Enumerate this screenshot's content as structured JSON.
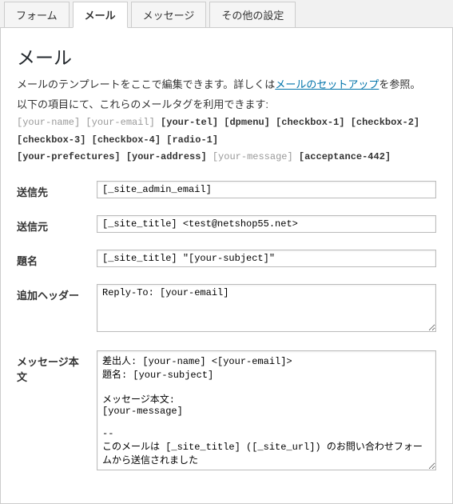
{
  "tabs": {
    "form": "フォーム",
    "mail": "メール",
    "messages": "メッセージ",
    "other": "その他の設定"
  },
  "heading": "メール",
  "desc_pre": "メールのテンプレートをここで編集できます。詳しくは",
  "desc_link": "メールのセットアップ",
  "desc_post": "を参照。",
  "legend": "以下の項目にて、これらのメールタグを利用できます:",
  "mail_tags_line1": [
    {
      "t": "[your-name]",
      "s": "gray"
    },
    {
      "t": "[your-email]",
      "s": "gray"
    },
    {
      "t": "[your-tel]",
      "s": "bold"
    },
    {
      "t": "[dpmenu]",
      "s": "bold"
    },
    {
      "t": "[checkbox-1]",
      "s": "bold"
    },
    {
      "t": "[checkbox-2]",
      "s": "bold"
    },
    {
      "t": "[checkbox-3]",
      "s": "bold"
    },
    {
      "t": "[checkbox-4]",
      "s": "bold"
    },
    {
      "t": "[radio-1]",
      "s": "bold"
    }
  ],
  "mail_tags_line2": [
    {
      "t": "[your-prefectures]",
      "s": "bold"
    },
    {
      "t": "[your-address]",
      "s": "bold"
    },
    {
      "t": "[your-message]",
      "s": "gray"
    },
    {
      "t": "[acceptance-442]",
      "s": "bold"
    }
  ],
  "fields": {
    "to": {
      "label": "送信先",
      "value": "[_site_admin_email]"
    },
    "from": {
      "label": "送信元",
      "value": "[_site_title] <test@netshop55.net>"
    },
    "subject": {
      "label": "題名",
      "value": "[_site_title] \"[your-subject]\""
    },
    "headers": {
      "label": "追加ヘッダー",
      "value": "Reply-To: [your-email]"
    },
    "body": {
      "label": "メッセージ本文",
      "value": "差出人: [your-name] <[your-email]>\n題名: [your-subject]\n\nメッセージ本文:\n[your-message]\n\n-- \nこのメールは [_site_title] ([_site_url]) のお問い合わせフォームから送信されました"
    }
  }
}
